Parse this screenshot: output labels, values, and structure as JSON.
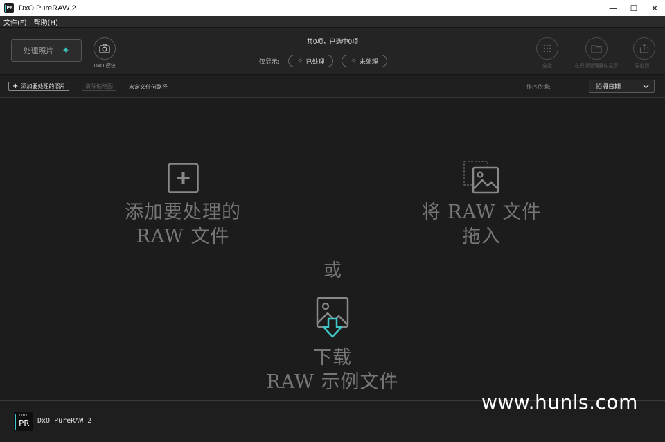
{
  "window": {
    "app_icon_text": "PR",
    "title": "DxO PureRAW 2",
    "minimize": "—",
    "maximize": "☐",
    "close": "✕"
  },
  "menu": {
    "items": [
      "文件(F)",
      "帮助(H)"
    ]
  },
  "toolbar": {
    "process_label": "处理照片",
    "process_icon": "sparkle-icon",
    "dxo_module_label": "DxO 模块",
    "counter": "共0项，已选中0项",
    "filter_label": "仅显示:",
    "filter_processed": "已处理",
    "filter_unprocessed": "未处理",
    "select_all": "全选",
    "show_in_explorer": "在资源管理器中显示",
    "export_to": "导出到..."
  },
  "subbar": {
    "add_label": "添加要处理的照片",
    "clear_thumbs": "清除缩略图",
    "path_status": "未定义任何路径",
    "sort_label": "排序依据:",
    "sort_value": "拍摄日期"
  },
  "main": {
    "add_raw_line1": "添加要处理的",
    "add_raw_line2": "RAW 文件",
    "drag_line1": "将 RAW 文件",
    "drag_line2": "拖入",
    "or_text": "或",
    "download_line1": "下载",
    "download_line2": "RAW 示例文件"
  },
  "footer": {
    "logo_small": "DXO",
    "logo_big": "PR",
    "app_name": "DxO PureRAW 2"
  },
  "watermark": "www.hunls.com",
  "colors": {
    "accent": "#3fc7c7",
    "background": "#1c1c1c",
    "toolbar": "#242424"
  }
}
